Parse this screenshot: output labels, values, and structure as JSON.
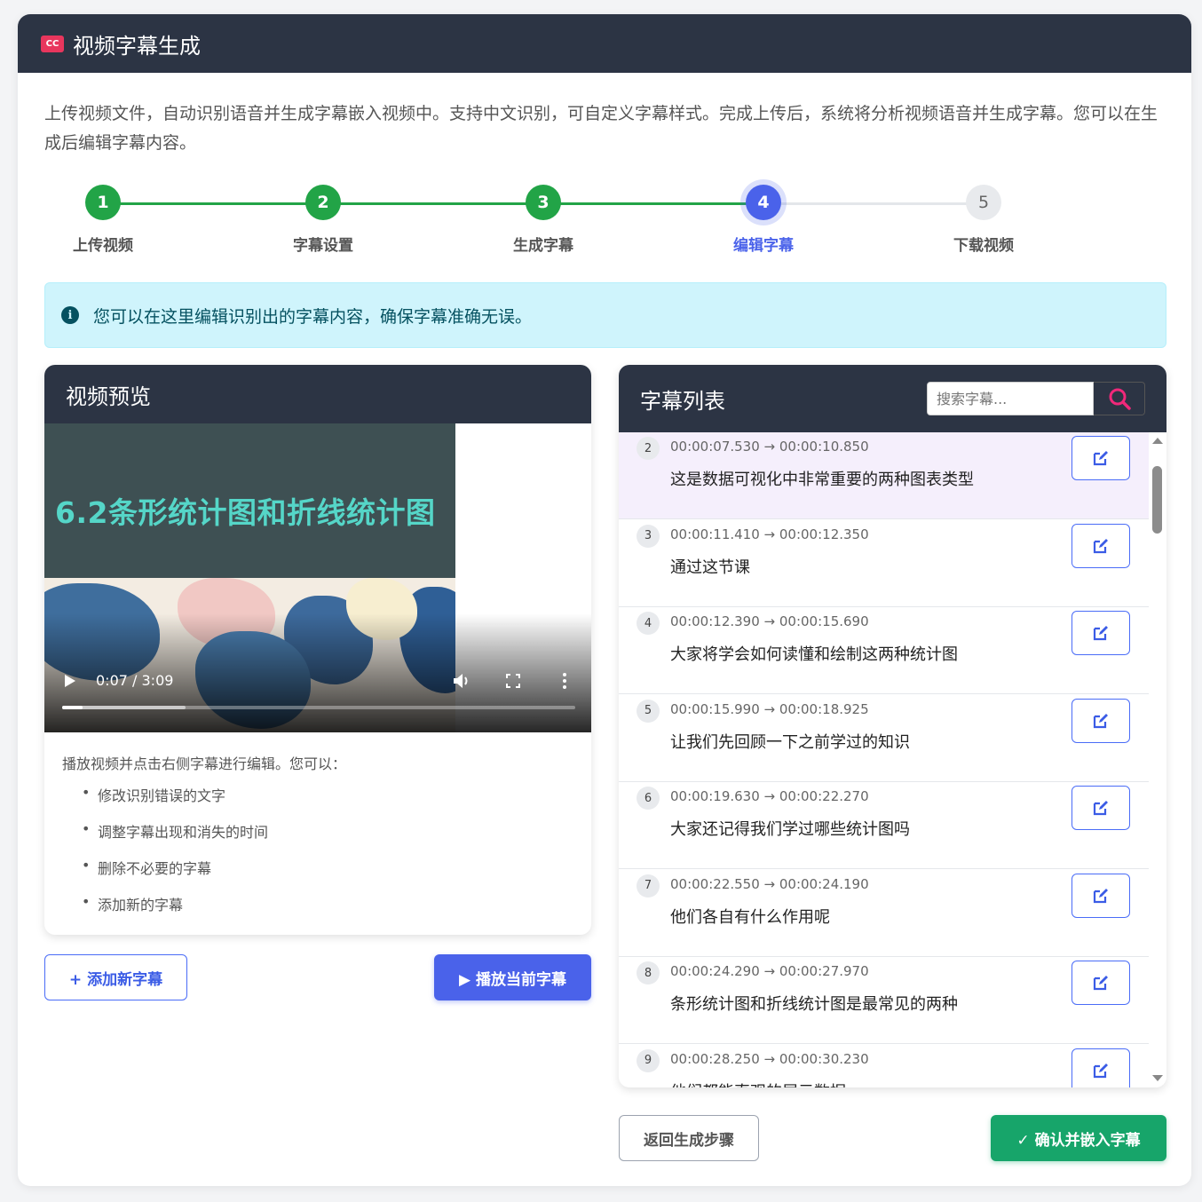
{
  "header": {
    "icon": "cc-icon",
    "title": "视频字幕生成"
  },
  "description": "上传视频文件，自动识别语音并生成字幕嵌入视频中。支持中文识别，可自定义字幕样式。完成上传后，系统将分析视频语音并生成字幕。您可以在生成后编辑字幕内容。",
  "steps": [
    {
      "num": "1",
      "label": "上传视频",
      "state": "done"
    },
    {
      "num": "2",
      "label": "字幕设置",
      "state": "done"
    },
    {
      "num": "3",
      "label": "生成字幕",
      "state": "done"
    },
    {
      "num": "4",
      "label": "编辑字幕",
      "state": "active"
    },
    {
      "num": "5",
      "label": "下载视频",
      "state": "pending"
    }
  ],
  "alert": {
    "icon": "info-icon",
    "text": "您可以在这里编辑识别出的字幕内容，确保字幕准确无误。"
  },
  "preview": {
    "title": "视频预览",
    "video_title": "6.2条形统计图和折线统计图",
    "time": "0:07 / 3:09",
    "progress": 0.04,
    "buffered": 0.24,
    "tips_intro": "播放视频并点击右侧字幕进行编辑。您可以：",
    "tips": [
      "修改识别错误的文字",
      "调整字幕出现和消失的时间",
      "删除不必要的字幕",
      "添加新的字幕"
    ]
  },
  "buttons": {
    "add": "+ 添加新字幕",
    "play": "▶ 播放当前字幕",
    "back": "返回生成步骤",
    "confirm": "✓ 确认并嵌入字幕"
  },
  "subtitle_list": {
    "title": "字幕列表",
    "search_placeholder": "搜索字幕...",
    "items": [
      {
        "num": "2",
        "time": "00:00:07.530 → 00:00:10.850",
        "text": "这是数据可视化中非常重要的两种图表类型",
        "active": true
      },
      {
        "num": "3",
        "time": "00:00:11.410 → 00:00:12.350",
        "text": "通过这节课"
      },
      {
        "num": "4",
        "time": "00:00:12.390 → 00:00:15.690",
        "text": "大家将学会如何读懂和绘制这两种统计图"
      },
      {
        "num": "5",
        "time": "00:00:15.990 → 00:00:18.925",
        "text": "让我们先回顾一下之前学过的知识"
      },
      {
        "num": "6",
        "time": "00:00:19.630 → 00:00:22.270",
        "text": "大家还记得我们学过哪些统计图吗"
      },
      {
        "num": "7",
        "time": "00:00:22.550 → 00:00:24.190",
        "text": "他们各自有什么作用呢"
      },
      {
        "num": "8",
        "time": "00:00:24.290 → 00:00:27.970",
        "text": "条形统计图和折线统计图是最常见的两种"
      },
      {
        "num": "9",
        "time": "00:00:28.250 → 00:00:30.230",
        "text": "他们都能直观的展示数据"
      }
    ]
  },
  "colors": {
    "header_bg": "#2c3444",
    "done": "#22a447",
    "active": "#4a62ea",
    "pending": "#e5e7eb",
    "confirm": "#17a56a"
  }
}
